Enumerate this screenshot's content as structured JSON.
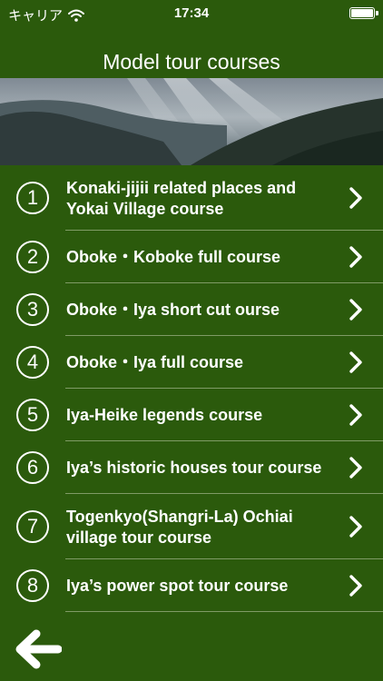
{
  "status_bar": {
    "carrier": "キャリア",
    "time": "17:34",
    "battery_level": 1.0
  },
  "header": {
    "title": "Model tour courses"
  },
  "courses": [
    {
      "number": "1",
      "label": "Konaki-jijii related places and Yokai Village course"
    },
    {
      "number": "2",
      "label": "Oboke・Koboke full course"
    },
    {
      "number": "3",
      "label": "Oboke・Iya short cut ourse"
    },
    {
      "number": "4",
      "label": "Oboke・Iya full course"
    },
    {
      "number": "5",
      "label": "Iya-Heike legends course"
    },
    {
      "number": "6",
      "label": "Iya’s historic houses tour course"
    },
    {
      "number": "7",
      "label": "Togenkyo(Shangri-La) Ochiai village tour course"
    },
    {
      "number": "8",
      "label": "Iya’s power spot tour course"
    }
  ],
  "icons": {
    "chevron": "chevron-right-icon",
    "back": "back-arrow-icon",
    "wifi": "wifi-icon",
    "battery": "battery-icon"
  },
  "colors": {
    "background": "#2b5a0c",
    "separator": "#7f9b66",
    "text": "#ffffff"
  }
}
